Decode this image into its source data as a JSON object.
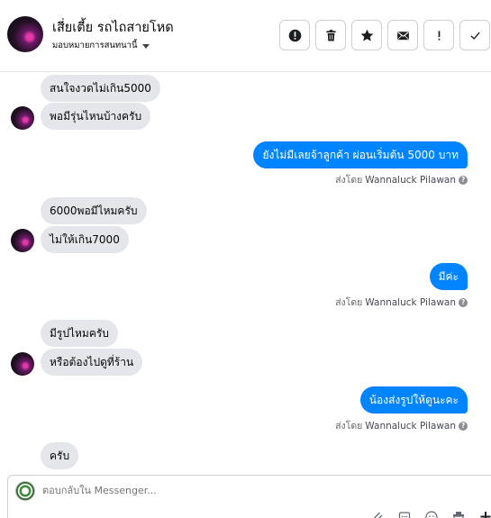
{
  "header": {
    "title": "เสี่ยเตี้ย รถไถสายโหด",
    "subtitle": "มอบหมายการสนทนานี้",
    "actions": [
      {
        "name": "report-button",
        "icon": "alert-circle-icon"
      },
      {
        "name": "delete-button",
        "icon": "trash-icon"
      },
      {
        "name": "star-button",
        "icon": "star-icon"
      },
      {
        "name": "mark-unread-button",
        "icon": "envelope-icon"
      },
      {
        "name": "spam-button",
        "icon": "exclamation-icon"
      },
      {
        "name": "mark-done-button",
        "icon": "check-icon"
      }
    ]
  },
  "thread": {
    "sent_by_label": "ส่งโดย",
    "agent_name": "Wannaluck Pilawan",
    "messages": [
      {
        "dir": "in",
        "text": "สนใจงวดไม่เกิน5000"
      },
      {
        "dir": "in",
        "text": "พอมีรุ่นไหนบ้างครับ"
      },
      {
        "dir": "out",
        "text": "ยังไม่มีเลยจ้าลูกค้า ผ่อนเริ่มต้น 5000 บาท"
      },
      {
        "dir": "in",
        "text": "6000พอมีไหมครับ"
      },
      {
        "dir": "in",
        "text": "ไม่ให้เกิน7000"
      },
      {
        "dir": "out",
        "text": "มีค่ะ"
      },
      {
        "dir": "in",
        "text": "มีรูปไหมครับ"
      },
      {
        "dir": "in",
        "text": "หรือต้องไปดูที่ร้าน"
      },
      {
        "dir": "out",
        "text": "น้องส่งรูปให้ดูนะคะ"
      },
      {
        "dir": "in",
        "text": "ครับ"
      }
    ]
  },
  "composer": {
    "placeholder": "ตอบกลับใน Messenger...",
    "tools": [
      "attachment-icon",
      "saved-reply-icon",
      "emoji-icon",
      "store-icon",
      "add-icon"
    ]
  }
}
